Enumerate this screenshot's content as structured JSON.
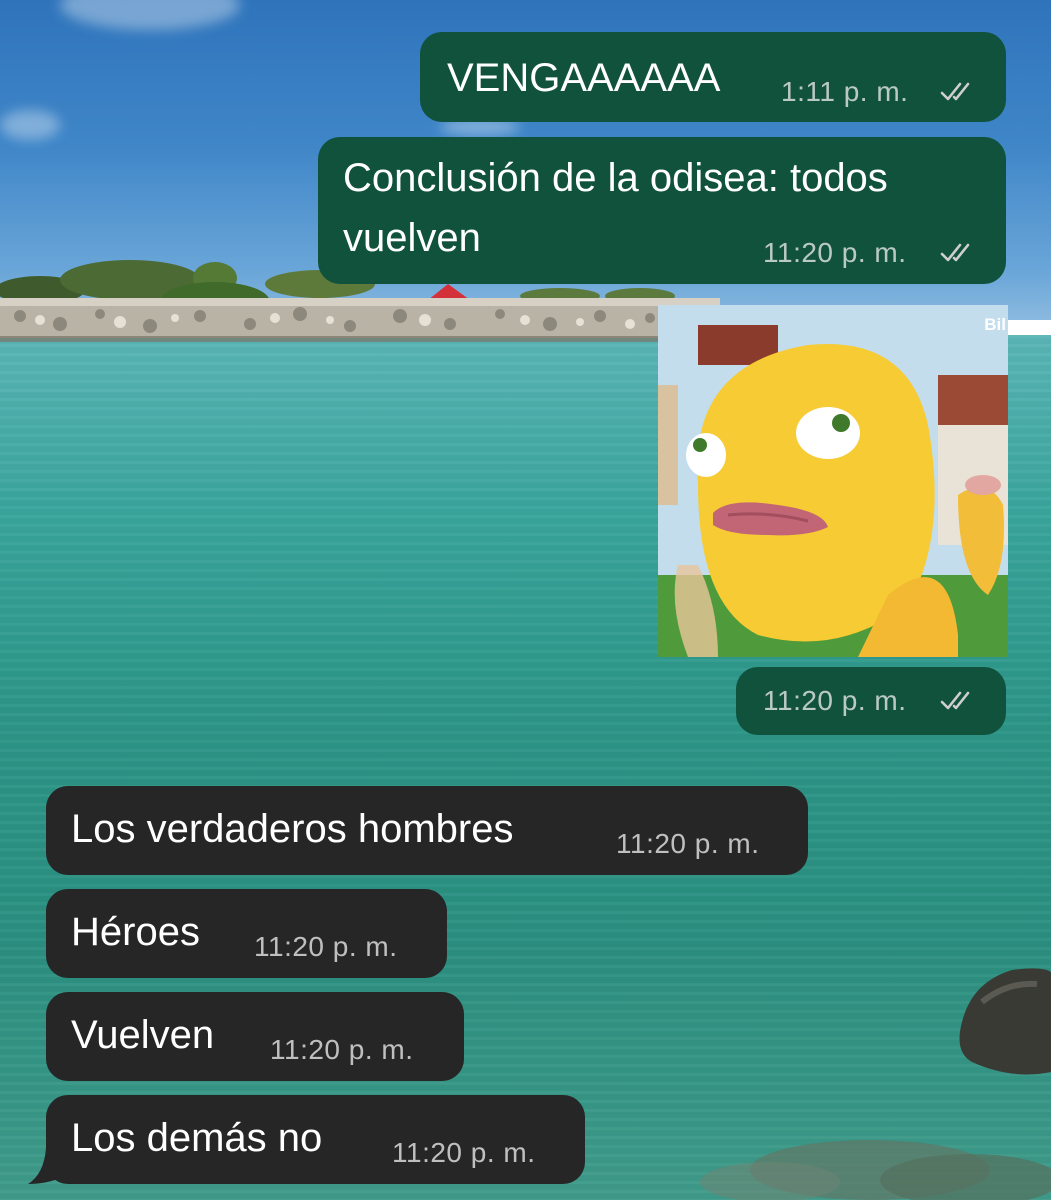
{
  "chat": {
    "messages": [
      {
        "direction": "outgoing",
        "text": "VENGAAAAAA",
        "time": "1:11 p. m.",
        "read": true
      },
      {
        "direction": "outgoing",
        "text_lines": [
          "Conclusión de la odisea: todos",
          "vuelven"
        ],
        "time": "11:20 p. m.",
        "read": true
      },
      {
        "direction": "outgoing",
        "type": "sticker",
        "sticker_icon": "yellow-cartoon-creature-tongue-out-sticker",
        "watermark": "Bil",
        "time": "11:20 p. m.",
        "read": true
      },
      {
        "direction": "incoming",
        "text": "Los verdaderos hombres",
        "time": "11:20 p. m."
      },
      {
        "direction": "incoming",
        "text": "Héroes",
        "time": "11:20 p. m."
      },
      {
        "direction": "incoming",
        "text": "Vuelven",
        "time": "11:20 p. m."
      },
      {
        "direction": "incoming",
        "text": "Los demás no",
        "time": "11:20 p. m."
      }
    ]
  },
  "theme": {
    "outgoing_bubble": "#11523d",
    "incoming_bubble": "#262626",
    "text": "#ffffff",
    "meta_text": "#d9d9d9"
  },
  "icons": {
    "read_receipt": "double-check-icon"
  },
  "wallpaper": "beach-photo-sky-sea-rocky-islet"
}
